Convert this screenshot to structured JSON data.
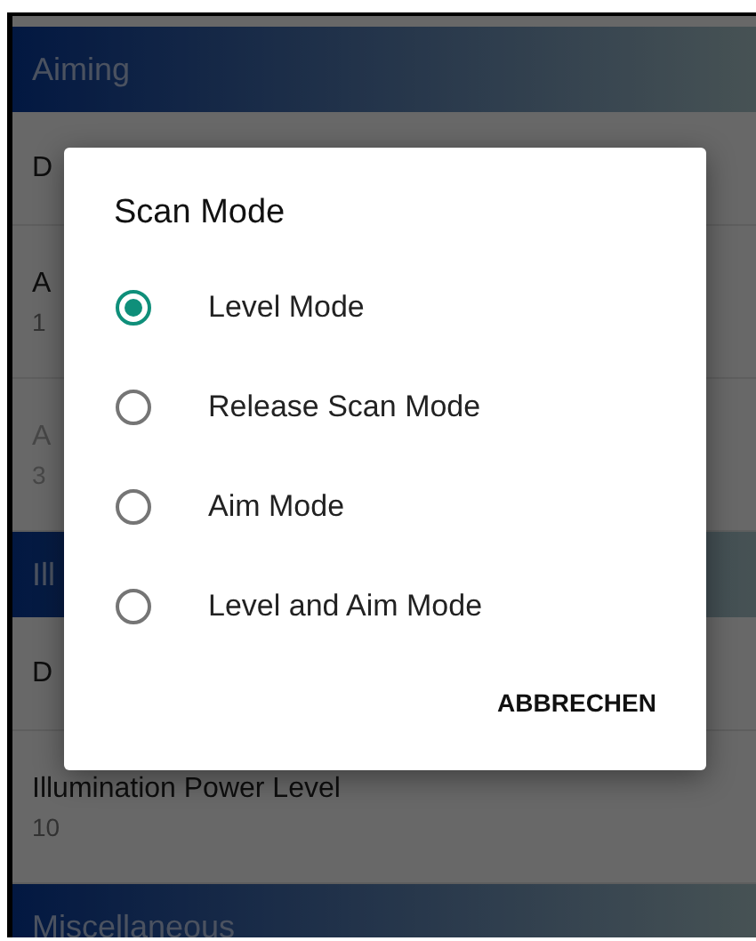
{
  "sections": [
    {
      "header": "Aiming",
      "rows": [
        {
          "title": "D",
          "disabled": false
        },
        {
          "title": "A",
          "value": "1",
          "disabled": false
        },
        {
          "title": "A",
          "value": "3",
          "disabled": true
        }
      ]
    },
    {
      "header": "Ill",
      "rows": [
        {
          "title": "D",
          "disabled": false
        },
        {
          "title": "Illumination Power Level",
          "value": "10",
          "disabled": false
        }
      ]
    },
    {
      "header": "Miscellaneous"
    }
  ],
  "dialog": {
    "title": "Scan Mode",
    "options": [
      {
        "label": "Level Mode",
        "selected": true
      },
      {
        "label": "Release Scan Mode",
        "selected": false
      },
      {
        "label": "Aim Mode",
        "selected": false
      },
      {
        "label": "Level and Aim Mode",
        "selected": false
      }
    ],
    "buttons": [
      "ABBRECHEN"
    ]
  }
}
